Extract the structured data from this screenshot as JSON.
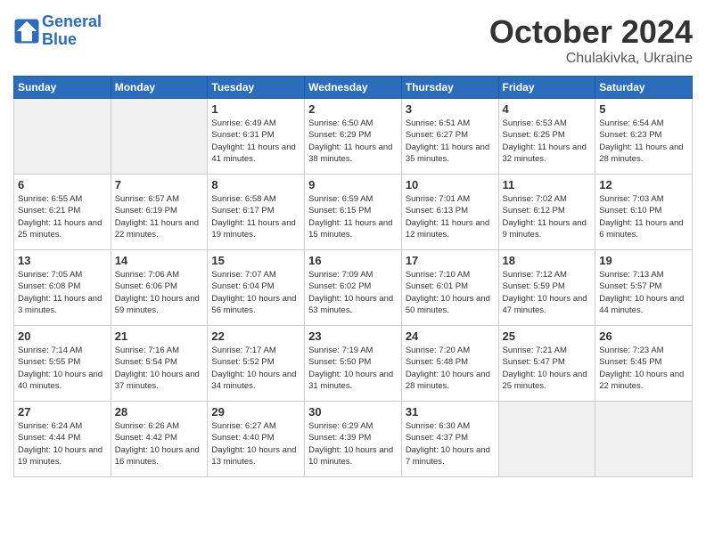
{
  "header": {
    "logo_line1": "General",
    "logo_line2": "Blue",
    "month": "October 2024",
    "location": "Chulakivka, Ukraine"
  },
  "weekdays": [
    "Sunday",
    "Monday",
    "Tuesday",
    "Wednesday",
    "Thursday",
    "Friday",
    "Saturday"
  ],
  "weeks": [
    [
      {
        "day": "",
        "empty": true
      },
      {
        "day": "",
        "empty": true
      },
      {
        "day": "1",
        "sunrise": "6:49 AM",
        "sunset": "6:31 PM",
        "daylight": "11 hours and 41 minutes."
      },
      {
        "day": "2",
        "sunrise": "6:50 AM",
        "sunset": "6:29 PM",
        "daylight": "11 hours and 38 minutes."
      },
      {
        "day": "3",
        "sunrise": "6:51 AM",
        "sunset": "6:27 PM",
        "daylight": "11 hours and 35 minutes."
      },
      {
        "day": "4",
        "sunrise": "6:53 AM",
        "sunset": "6:25 PM",
        "daylight": "11 hours and 32 minutes."
      },
      {
        "day": "5",
        "sunrise": "6:54 AM",
        "sunset": "6:23 PM",
        "daylight": "11 hours and 28 minutes."
      }
    ],
    [
      {
        "day": "6",
        "sunrise": "6:55 AM",
        "sunset": "6:21 PM",
        "daylight": "11 hours and 25 minutes."
      },
      {
        "day": "7",
        "sunrise": "6:57 AM",
        "sunset": "6:19 PM",
        "daylight": "11 hours and 22 minutes."
      },
      {
        "day": "8",
        "sunrise": "6:58 AM",
        "sunset": "6:17 PM",
        "daylight": "11 hours and 19 minutes."
      },
      {
        "day": "9",
        "sunrise": "6:59 AM",
        "sunset": "6:15 PM",
        "daylight": "11 hours and 15 minutes."
      },
      {
        "day": "10",
        "sunrise": "7:01 AM",
        "sunset": "6:13 PM",
        "daylight": "11 hours and 12 minutes."
      },
      {
        "day": "11",
        "sunrise": "7:02 AM",
        "sunset": "6:12 PM",
        "daylight": "11 hours and 9 minutes."
      },
      {
        "day": "12",
        "sunrise": "7:03 AM",
        "sunset": "6:10 PM",
        "daylight": "11 hours and 6 minutes."
      }
    ],
    [
      {
        "day": "13",
        "sunrise": "7:05 AM",
        "sunset": "6:08 PM",
        "daylight": "11 hours and 3 minutes."
      },
      {
        "day": "14",
        "sunrise": "7:06 AM",
        "sunset": "6:06 PM",
        "daylight": "10 hours and 59 minutes."
      },
      {
        "day": "15",
        "sunrise": "7:07 AM",
        "sunset": "6:04 PM",
        "daylight": "10 hours and 56 minutes."
      },
      {
        "day": "16",
        "sunrise": "7:09 AM",
        "sunset": "6:02 PM",
        "daylight": "10 hours and 53 minutes."
      },
      {
        "day": "17",
        "sunrise": "7:10 AM",
        "sunset": "6:01 PM",
        "daylight": "10 hours and 50 minutes."
      },
      {
        "day": "18",
        "sunrise": "7:12 AM",
        "sunset": "5:59 PM",
        "daylight": "10 hours and 47 minutes."
      },
      {
        "day": "19",
        "sunrise": "7:13 AM",
        "sunset": "5:57 PM",
        "daylight": "10 hours and 44 minutes."
      }
    ],
    [
      {
        "day": "20",
        "sunrise": "7:14 AM",
        "sunset": "5:55 PM",
        "daylight": "10 hours and 40 minutes."
      },
      {
        "day": "21",
        "sunrise": "7:16 AM",
        "sunset": "5:54 PM",
        "daylight": "10 hours and 37 minutes."
      },
      {
        "day": "22",
        "sunrise": "7:17 AM",
        "sunset": "5:52 PM",
        "daylight": "10 hours and 34 minutes."
      },
      {
        "day": "23",
        "sunrise": "7:19 AM",
        "sunset": "5:50 PM",
        "daylight": "10 hours and 31 minutes."
      },
      {
        "day": "24",
        "sunrise": "7:20 AM",
        "sunset": "5:48 PM",
        "daylight": "10 hours and 28 minutes."
      },
      {
        "day": "25",
        "sunrise": "7:21 AM",
        "sunset": "5:47 PM",
        "daylight": "10 hours and 25 minutes."
      },
      {
        "day": "26",
        "sunrise": "7:23 AM",
        "sunset": "5:45 PM",
        "daylight": "10 hours and 22 minutes."
      }
    ],
    [
      {
        "day": "27",
        "sunrise": "6:24 AM",
        "sunset": "4:44 PM",
        "daylight": "10 hours and 19 minutes."
      },
      {
        "day": "28",
        "sunrise": "6:26 AM",
        "sunset": "4:42 PM",
        "daylight": "10 hours and 16 minutes."
      },
      {
        "day": "29",
        "sunrise": "6:27 AM",
        "sunset": "4:40 PM",
        "daylight": "10 hours and 13 minutes."
      },
      {
        "day": "30",
        "sunrise": "6:29 AM",
        "sunset": "4:39 PM",
        "daylight": "10 hours and 10 minutes."
      },
      {
        "day": "31",
        "sunrise": "6:30 AM",
        "sunset": "4:37 PM",
        "daylight": "10 hours and 7 minutes."
      },
      {
        "day": "",
        "empty": true
      },
      {
        "day": "",
        "empty": true
      }
    ]
  ]
}
